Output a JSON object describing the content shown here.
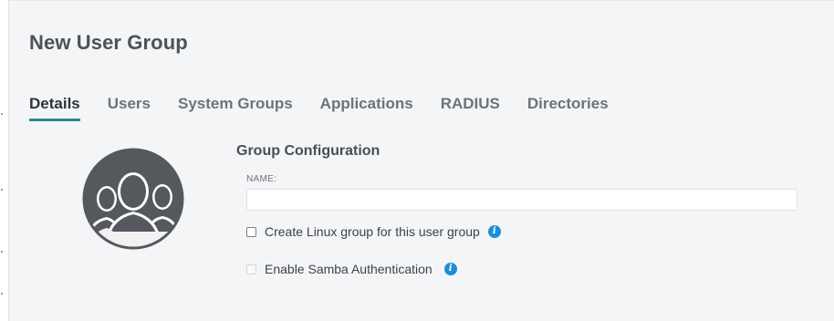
{
  "dialog": {
    "title": "New User Group"
  },
  "tabs": [
    {
      "label": "Details",
      "active": true
    },
    {
      "label": "Users",
      "active": false
    },
    {
      "label": "System Groups",
      "active": false
    },
    {
      "label": "Applications",
      "active": false
    },
    {
      "label": "RADIUS",
      "active": false
    },
    {
      "label": "Directories",
      "active": false
    }
  ],
  "avatar": {
    "icon": "user-group-icon"
  },
  "group_config": {
    "title": "Group Configuration",
    "name_label": "NAME:",
    "name_value": "",
    "name_placeholder": ""
  },
  "options": {
    "linux_group": {
      "label": "Create Linux group for this user group",
      "checked": false,
      "enabled": true,
      "icon": "info-icon"
    },
    "samba_auth": {
      "label": "Enable Samba Authentication",
      "checked": false,
      "enabled": false,
      "icon": "info-icon"
    }
  },
  "colors": {
    "accent": "#2a8a8e",
    "info": "#1a8fd6",
    "panel_bg": "#f4f5f6",
    "avatar_bg": "#55585c"
  }
}
